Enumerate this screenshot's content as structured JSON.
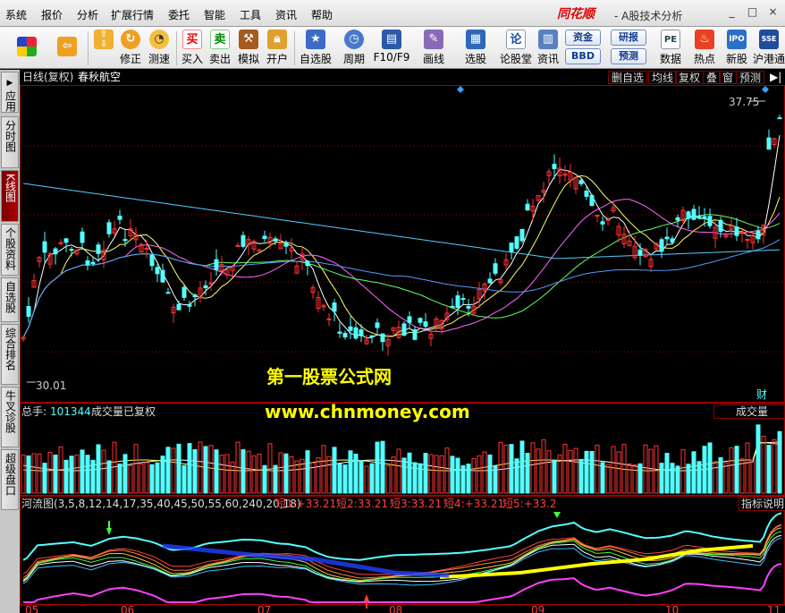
{
  "menubar": {
    "items": [
      "系统",
      "报价",
      "分析",
      "扩展行情",
      "委托",
      "智能",
      "工具",
      "资讯",
      "帮助"
    ],
    "logo": "同花顺",
    "title": "- A股技术分析",
    "win_buttons": [
      "_",
      "□",
      "×"
    ]
  },
  "toolbar": {
    "buttons": [
      {
        "label": "",
        "icon": "grid-color-icon"
      },
      {
        "label": "",
        "icon": "back-arrow-icon"
      },
      {
        "label": "修正",
        "icon": "up-down-arrow-icon"
      },
      {
        "label": "测速",
        "icon": "refresh-icon"
      },
      {
        "label": "",
        "icon": "clock-icon"
      },
      {
        "label": "买入",
        "icon": "buy-icon",
        "glyph": "买"
      },
      {
        "label": "卖出",
        "icon": "sell-icon",
        "glyph": "卖"
      },
      {
        "label": "模拟",
        "icon": "hammer-icon"
      },
      {
        "label": "开户",
        "icon": "lock-icon"
      },
      {
        "label": "自选股",
        "icon": "star-icon"
      },
      {
        "label": "周期",
        "icon": "period-icon"
      },
      {
        "label": "F10/F9",
        "icon": "f10-icon"
      },
      {
        "label": "画线",
        "icon": "pen-icon"
      },
      {
        "label": "选股",
        "icon": "select-stock-icon"
      },
      {
        "label": "论股堂",
        "icon": "forum-icon",
        "glyph": "论"
      },
      {
        "label": "资讯",
        "icon": "news-icon"
      },
      {
        "label": "数据",
        "icon": "pe-icon",
        "glyph": "PE"
      },
      {
        "label": "热点",
        "icon": "hot-icon"
      },
      {
        "label": "新股",
        "icon": "ipo-icon",
        "glyph": "IPO"
      },
      {
        "label": "沪港通",
        "icon": "shhk-icon",
        "glyph": "SSE"
      }
    ],
    "data_buttons": [
      "资金",
      "BBD",
      "研报",
      "预测"
    ]
  },
  "left_tabs": [
    {
      "label": "应用",
      "active": false
    },
    {
      "label": "分时图",
      "active": false
    },
    {
      "label": "K线图",
      "active": true
    },
    {
      "label": "个股资料",
      "active": false
    },
    {
      "label": "自选股",
      "active": false
    },
    {
      "label": "综合排名",
      "active": false
    },
    {
      "label": "牛叉诊股",
      "active": false
    },
    {
      "label": "超级盘口",
      "active": false
    }
  ],
  "chart_header": {
    "period": "日线(复权)",
    "stock_name": "春秋航空",
    "right_tabs": [
      "删自选",
      "均线",
      "复权",
      "叠",
      "窗",
      "预测"
    ]
  },
  "price_panel": {
    "high_label": "37.75",
    "low_label": "30.01",
    "fin_badge": "财"
  },
  "volume_panel": {
    "label": "总手:",
    "value": "101344",
    "note": "成交量已复权",
    "tab": "成交量"
  },
  "indicator_panel": {
    "name": "河流图(3,5,8,12,14,17,35,40,45,50,55,60,240,20,18)",
    "values": [
      {
        "label": "短1:",
        "value": "+33.21"
      },
      {
        "label": "短2:",
        "value": "33.21"
      },
      {
        "label": "短3:",
        "value": "33.21"
      },
      {
        "label": "短4:",
        "value": "+33.21"
      },
      {
        "label": "短5:",
        "value": "+33.2"
      }
    ],
    "help": "指标说明"
  },
  "x_axis_months": [
    "05",
    "06",
    "07",
    "08",
    "09",
    "10",
    "11"
  ],
  "watermark": {
    "line1": "第一股票公式网",
    "line2": "www.chnmoney.com"
  },
  "colors": {
    "up_candle": "#ff3232",
    "down_candle": "#54ffff",
    "panel_border": "#a00000",
    "accent_yellow": "#ffff00"
  },
  "chart_data": {
    "type": "candlestick",
    "x_axis_labels": [
      "05",
      "06",
      "07",
      "08",
      "09",
      "10",
      "11"
    ],
    "price_markers": {
      "high": 37.75,
      "low": 30.01
    },
    "volume_current": 101344
  }
}
